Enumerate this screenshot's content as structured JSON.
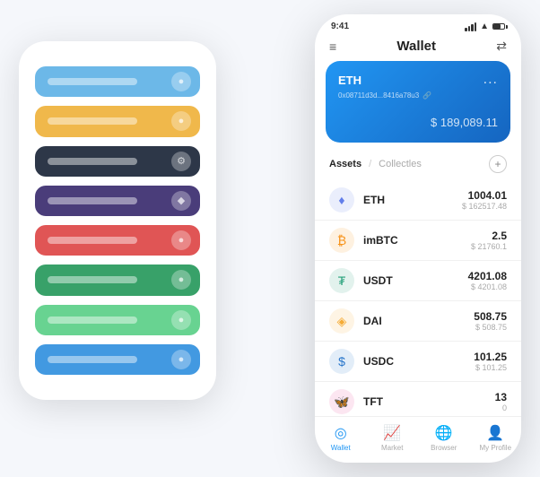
{
  "scene": {
    "back_phone": {
      "cards": [
        {
          "color": "#6cb8e8",
          "label": "",
          "icon": "●"
        },
        {
          "color": "#f0b84b",
          "label": "",
          "icon": "●"
        },
        {
          "color": "#2d3748",
          "label": "",
          "icon": "⚙"
        },
        {
          "color": "#4a3d7a",
          "label": "",
          "icon": "◆"
        },
        {
          "color": "#e05555",
          "label": "",
          "icon": "●"
        },
        {
          "color": "#38a169",
          "label": "",
          "icon": "●"
        },
        {
          "color": "#68d391",
          "label": "",
          "icon": "●"
        },
        {
          "color": "#4299e1",
          "label": "",
          "icon": "●"
        }
      ]
    },
    "front_phone": {
      "status_bar": {
        "time": "9:41",
        "battery": "100"
      },
      "header": {
        "menu_icon": "≡",
        "title": "Wallet",
        "scan_icon": "⇄"
      },
      "eth_card": {
        "title": "ETH",
        "dots": "...",
        "address": "0x08711d3d...8416a78u3",
        "amount": "$ 189,089.11",
        "currency_symbol": "$"
      },
      "assets_section": {
        "tab_active": "Assets",
        "divider": "/",
        "tab_inactive": "Collectles",
        "add_icon": "+"
      },
      "asset_list": [
        {
          "name": "ETH",
          "icon_color": "#627eea",
          "icon_symbol": "♦",
          "amount_primary": "1004.01",
          "amount_secondary": "$ 162517.48"
        },
        {
          "name": "imBTC",
          "icon_color": "#f7931a",
          "icon_symbol": "₿",
          "amount_primary": "2.5",
          "amount_secondary": "$ 21760.1"
        },
        {
          "name": "USDT",
          "icon_color": "#26a17b",
          "icon_symbol": "₮",
          "amount_primary": "4201.08",
          "amount_secondary": "$ 4201.08"
        },
        {
          "name": "DAI",
          "icon_color": "#f5ac37",
          "icon_symbol": "◈",
          "amount_primary": "508.75",
          "amount_secondary": "$ 508.75"
        },
        {
          "name": "USDC",
          "icon_color": "#2775ca",
          "icon_symbol": "$",
          "amount_primary": "101.25",
          "amount_secondary": "$ 101.25"
        },
        {
          "name": "TFT",
          "icon_color": "#e84393",
          "icon_symbol": "🦋",
          "amount_primary": "13",
          "amount_secondary": "0"
        }
      ],
      "bottom_nav": [
        {
          "label": "Wallet",
          "icon": "◎",
          "active": true
        },
        {
          "label": "Market",
          "icon": "📊",
          "active": false
        },
        {
          "label": "Browser",
          "icon": "👤",
          "active": false
        },
        {
          "label": "My Profile",
          "icon": "👤",
          "active": false
        }
      ]
    }
  }
}
